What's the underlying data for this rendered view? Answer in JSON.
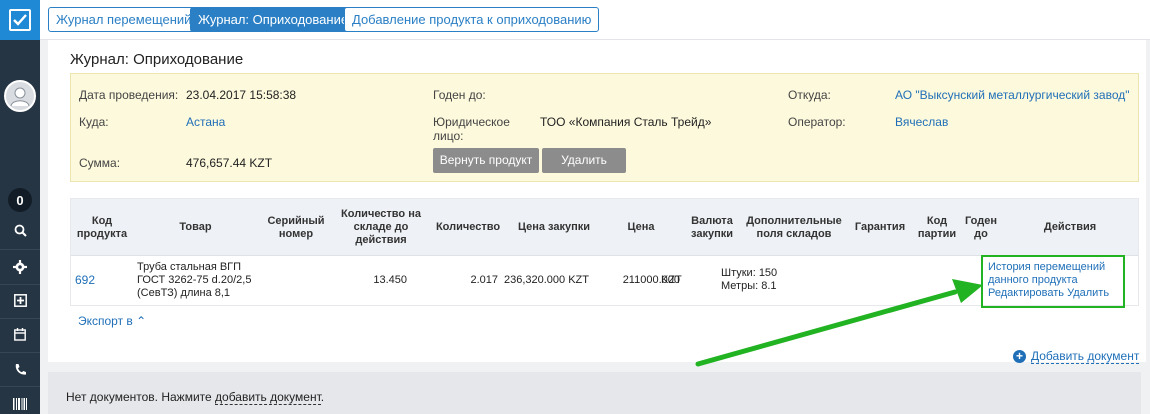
{
  "tabs": [
    {
      "label": "Журнал перемещений"
    },
    {
      "label": "Журнал: Оприходование"
    },
    {
      "label": "Добавление продукта к оприходованию"
    }
  ],
  "sidebar": {
    "badge": "0",
    "icons": [
      "check-logo-icon",
      "avatar-icon",
      "search-icon",
      "gear-icon",
      "plus-square-icon",
      "calendar-icon",
      "phone-icon",
      "barcode-icon"
    ]
  },
  "page": {
    "title": "Журнал: Оприходование"
  },
  "info": {
    "date_label": "Дата проведения:",
    "date_value": "23.04.2017 15:58:38",
    "valid_label": "Годен до:",
    "from_label": "Откуда:",
    "from_value": "АО \"Выксунский металлургический завод\"",
    "to_label": "Куда:",
    "to_value": "Астана",
    "legal_label_1": "Юридическое",
    "legal_label_2": "лицо:",
    "legal_value": "ТОО «Компания Сталь Трейд»",
    "operator_label": "Оператор:",
    "operator_value": "Вячеслав",
    "sum_label": "Сумма:",
    "sum_value": "476,657.44 KZT",
    "return_button": "Вернуть продукт",
    "delete_button": "Удалить"
  },
  "table": {
    "headers": [
      [
        "Код",
        "продукта"
      ],
      [
        "Товар"
      ],
      [
        "Серийный",
        "номер"
      ],
      [
        "Количество на",
        "складе до",
        "действия"
      ],
      [
        "Количество"
      ],
      [
        "Цена закупки"
      ],
      [
        "Цена"
      ],
      [
        "Валюта",
        "закупки"
      ],
      [
        "Дополнительные",
        "поля складов"
      ],
      [
        "Гарантия"
      ],
      [
        "Код",
        "партии"
      ],
      [
        "Годен",
        "до"
      ],
      [
        "Действия"
      ]
    ],
    "row": {
      "code": "692",
      "product_1": "Труба стальная ВГП",
      "product_2": "ГОСТ 3262-75 d.20/2,5",
      "product_3": "(СевТЗ) длина 8,1",
      "stock_before": "13.450",
      "quantity": "2.017",
      "purchase_price": "236,320.000 KZT",
      "price": "211000.000",
      "currency": "KZT",
      "extra_1": "Штуки: 150",
      "extra_2": "Метры: 8.1",
      "action_history_1": "История перемещений",
      "action_history_2": "данного продукта",
      "action_edit": "Редактировать",
      "action_delete": "Удалить"
    }
  },
  "export_label": "Экспорт в",
  "add_document": "Добавить документ",
  "empty": {
    "prefix": "Нет документов. Нажмите ",
    "link": "добавить документ",
    "suffix": "."
  },
  "colors": {
    "accent": "#2a7fc5",
    "highlight": "#22b322",
    "sidebar": "#263544"
  }
}
